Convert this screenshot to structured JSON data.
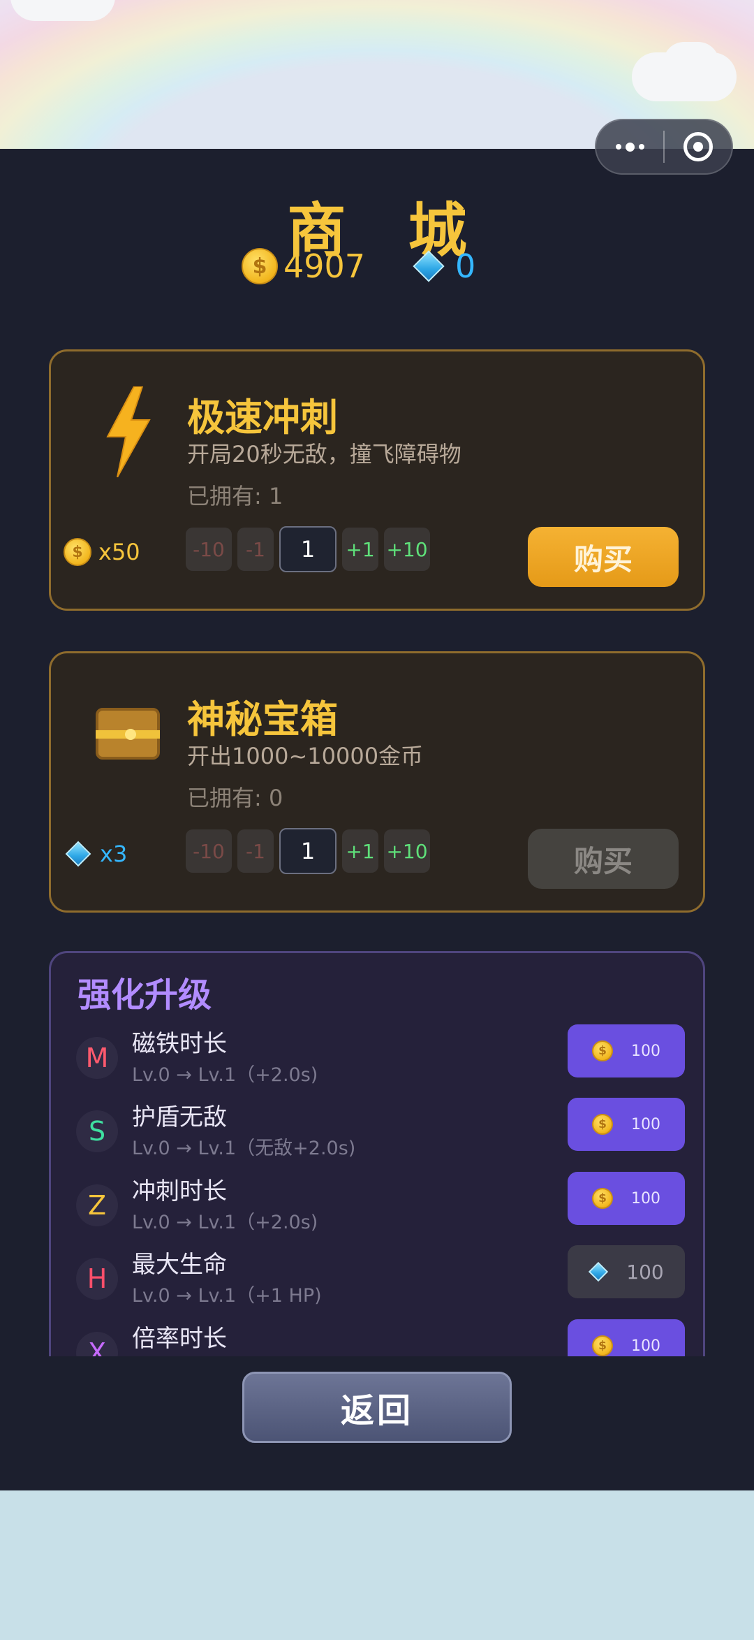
{
  "capsule": {
    "more_icon": "more-dots-icon",
    "close_icon": "target-close-icon"
  },
  "header": {
    "title": "商 城",
    "gold": "4907",
    "gems": "0",
    "coin_symbol": "$"
  },
  "items": [
    {
      "name": "极速冲刺",
      "desc": "开局20秒无敌，撞飞障碍物",
      "owned": "已拥有: 1",
      "price": "x50",
      "price_currency": "gold",
      "price_color": "#f6c53c",
      "steps": {
        "minus10": "-10",
        "minus1": "-1",
        "qty": "1",
        "plus1": "+1",
        "plus10": "+10"
      },
      "buy": "购买",
      "buy_enabled": true,
      "icon": "lightning-icon"
    },
    {
      "name": "神秘宝箱",
      "desc": "开出1000~10000金币",
      "owned": "已拥有: 0",
      "price": "x3",
      "price_currency": "gem",
      "price_color": "#35b7ff",
      "steps": {
        "minus10": "-10",
        "minus1": "-1",
        "qty": "1",
        "plus1": "+1",
        "plus10": "+10"
      },
      "buy": "购买",
      "buy_enabled": false,
      "icon": "treasure-chest-icon"
    }
  ],
  "upgrade": {
    "title": "强化升级",
    "rows": [
      {
        "letter": "M",
        "color": "#ff5a6e",
        "name": "磁铁时长",
        "sub": "Lv.0 → Lv.1（+2.0s)",
        "cost": "100",
        "currency": "gold",
        "enabled": true
      },
      {
        "letter": "S",
        "color": "#3fe0a0",
        "name": "护盾无敌",
        "sub": "Lv.0 → Lv.1（无敌+2.0s)",
        "cost": "100",
        "currency": "gold",
        "enabled": true
      },
      {
        "letter": "Z",
        "color": "#f6c53c",
        "name": "冲刺时长",
        "sub": "Lv.0 → Lv.1（+2.0s)",
        "cost": "100",
        "currency": "gold",
        "enabled": true
      },
      {
        "letter": "H",
        "color": "#ff4f6b",
        "name": "最大生命",
        "sub": "Lv.0 → Lv.1（+1 HP)",
        "cost": "100",
        "currency": "gem",
        "enabled": false
      },
      {
        "letter": "X",
        "color": "#c76bff",
        "name": "倍率时长",
        "sub": "",
        "cost": "100",
        "currency": "gold",
        "enabled": true
      }
    ]
  },
  "back": "返回"
}
